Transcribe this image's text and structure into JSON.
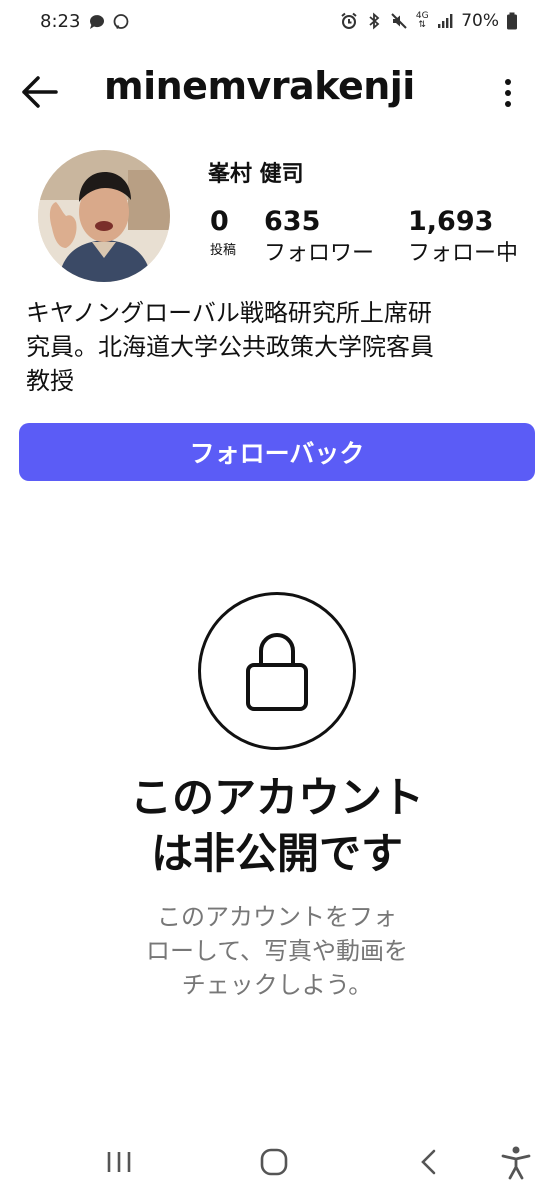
{
  "status_bar": {
    "time": "8:23",
    "battery": "70%",
    "network_label": "4G",
    "left_icons": [
      "chat-bubble-icon",
      "messenger-icon"
    ],
    "right_icons": [
      "alarm-icon",
      "bluetooth-icon",
      "mute-icon",
      "network-arrows-icon",
      "signal-icon",
      "battery-icon"
    ]
  },
  "header": {
    "username": "minemvrakenji",
    "back_icon": "back-arrow-icon",
    "menu_icon": "more-vertical-icon"
  },
  "profile": {
    "display_name": "峯村 健司",
    "stats": [
      {
        "value": "0",
        "label": "投稿"
      },
      {
        "value": "635",
        "label": "フォロワー"
      },
      {
        "value": "1,693",
        "label": "フォロー中"
      }
    ],
    "bio": [
      "キヤノングローバル戦略研究所上席研",
      "究員。北海道大学公共政策大学院客員",
      "教授"
    ]
  },
  "actions": {
    "follow_back_label": "フォローバック",
    "accent_color": "#5b5cf6"
  },
  "private_notice": {
    "title_lines": [
      "このアカウント",
      "は非公開です"
    ],
    "subtitle_lines": [
      "このアカウントをフォ",
      "ローして、写真や動画を",
      "チェックしよう。"
    ],
    "icon": "lock-icon"
  },
  "nav_bar": {
    "icons": [
      "recent-apps-icon",
      "home-icon",
      "back-icon",
      "accessibility-icon"
    ]
  }
}
